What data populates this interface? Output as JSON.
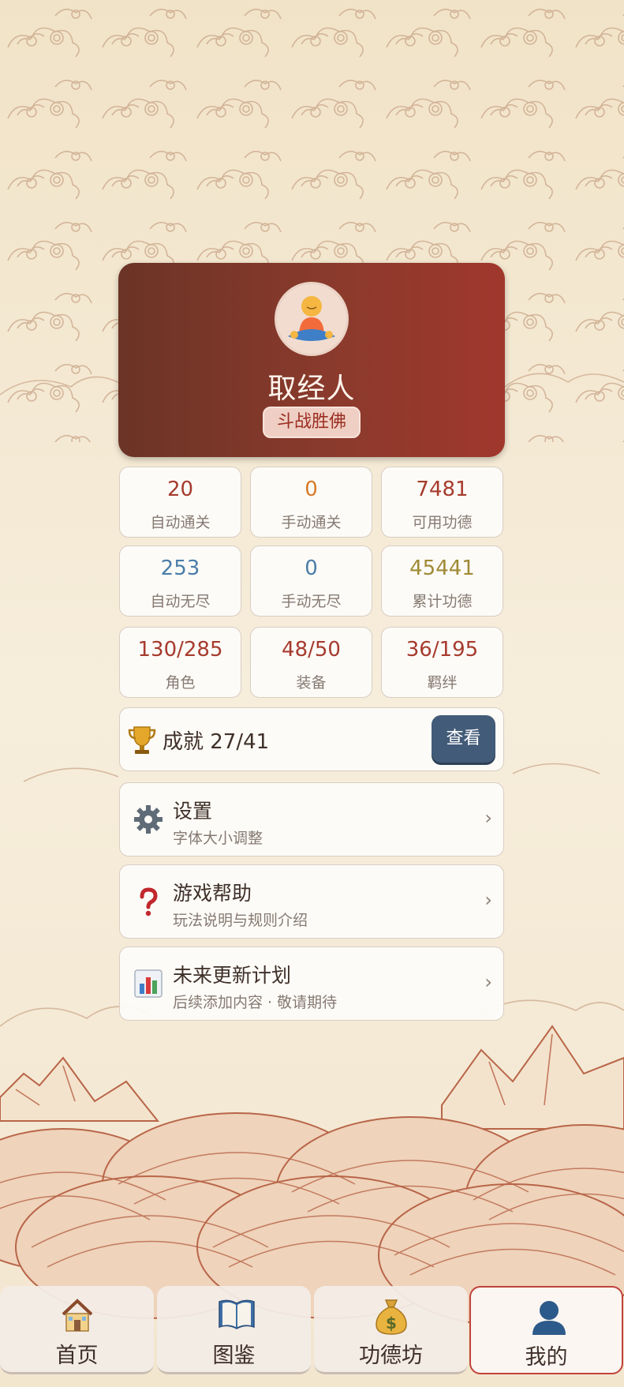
{
  "profile": {
    "name": "取经人",
    "rank": "斗战胜佛"
  },
  "stats": [
    {
      "value": "20",
      "label": "自动通关",
      "color": "#a63b2e"
    },
    {
      "value": "0",
      "label": "手动通关",
      "color": "#d67a2a"
    },
    {
      "value": "7481",
      "label": "可用功德",
      "color": "#a63b2e"
    },
    {
      "value": "253",
      "label": "自动无尽",
      "color": "#4a7da8"
    },
    {
      "value": "0",
      "label": "手动无尽",
      "color": "#4a7da8"
    },
    {
      "value": "45441",
      "label": "累计功德",
      "color": "#a08a36"
    },
    {
      "value": "130/285",
      "label": "角色",
      "color": "#a63b2e"
    },
    {
      "value": "48/50",
      "label": "装备",
      "color": "#a63b2e"
    },
    {
      "value": "36/195",
      "label": "羁绊",
      "color": "#a63b2e"
    }
  ],
  "achievement": {
    "text": "成就 27/41",
    "button": "查看",
    "icon": "trophy-icon"
  },
  "menu": [
    {
      "title": "设置",
      "subtitle": "字体大小调整",
      "icon": "gear-icon"
    },
    {
      "title": "游戏帮助",
      "subtitle": "玩法说明与规则介绍",
      "icon": "question-icon"
    },
    {
      "title": "未来更新计划",
      "subtitle": "后续添加内容 · 敬请期待",
      "icon": "bar-chart-icon"
    }
  ],
  "chevron": "›",
  "nav": [
    {
      "label": "首页",
      "icon": "house-icon"
    },
    {
      "label": "图鉴",
      "icon": "book-icon"
    },
    {
      "label": "功德坊",
      "icon": "money-bag-icon"
    },
    {
      "label": "我的",
      "icon": "user-icon"
    }
  ],
  "colors": {
    "accent": "#8a3a2c",
    "button": "#425b78",
    "active_tab_border": "#c0433a"
  }
}
